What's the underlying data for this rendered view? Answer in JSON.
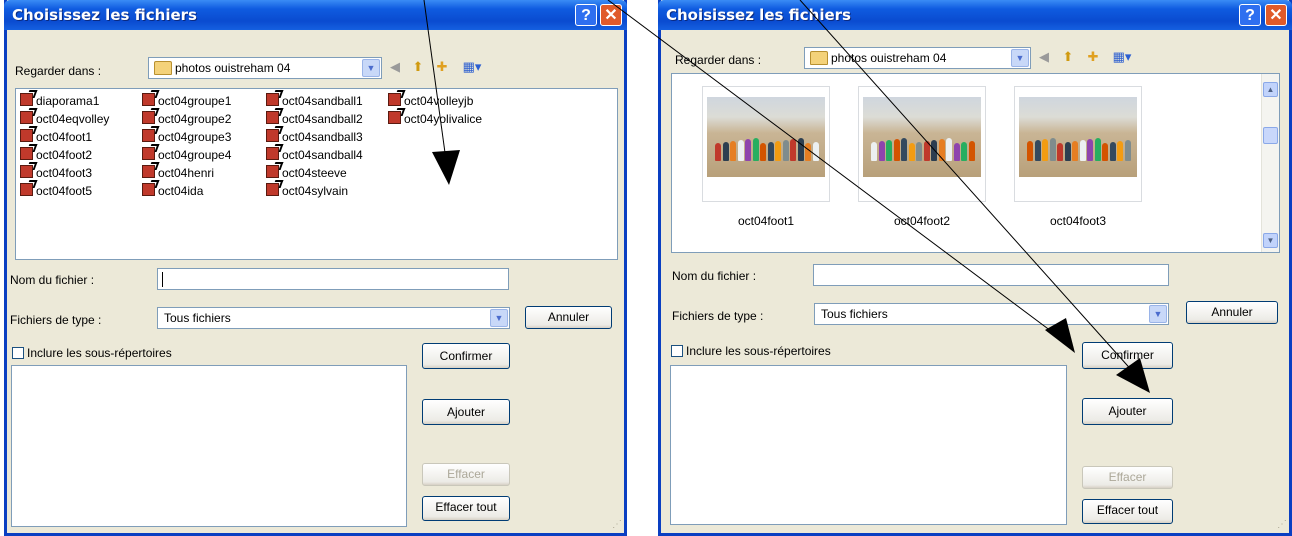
{
  "colors": {
    "titlebar": "#0a4bd0",
    "dialog_bg": "#ece9d8",
    "border": "#0a3fc2",
    "close": "#e05a2a"
  },
  "left_dialog": {
    "title": "Choisissez les fichiers",
    "help_label": "?",
    "close_label": "✕",
    "look_in_label": "Regarder dans :",
    "look_in_value": "photos ouistreham 04",
    "toolbar_icons": [
      "back-icon",
      "up-folder-icon",
      "new-folder-icon",
      "view-menu-icon"
    ],
    "files": [
      "diaporama1",
      "oct04eqvolley",
      "oct04foot1",
      "oct04foot2",
      "oct04foot3",
      "oct04foot5",
      "oct04groupe1",
      "oct04groupe2",
      "oct04groupe3",
      "oct04groupe4",
      "oct04henri",
      "oct04ida",
      "oct04sandball1",
      "oct04sandball2",
      "oct04sandball3",
      "oct04sandball4",
      "oct04steeve",
      "oct04sylvain",
      "oct04volleyjb",
      "oct04yolivalice"
    ],
    "filename_label": "Nom du fichier :",
    "filename_value": "",
    "filetype_label": "Fichiers de type :",
    "filetype_value": "Tous fichiers",
    "cancel_label": "Annuler",
    "include_sub_label": "Inclure les sous-répertoires",
    "include_sub_checked": false,
    "confirm_label": "Confirmer",
    "add_label": "Ajouter",
    "clear_label": "Effacer",
    "clear_all_label": "Effacer tout"
  },
  "right_dialog": {
    "title": "Choisissez les fichiers",
    "help_label": "?",
    "close_label": "✕",
    "look_in_label": "Regarder dans :",
    "look_in_value": "photos ouistreham 04",
    "thumbnails": [
      "oct04foot1",
      "oct04foot2",
      "oct04foot3"
    ],
    "filename_label": "Nom du fichier :",
    "filename_value": "",
    "filetype_label": "Fichiers de type :",
    "filetype_value": "Tous fichiers",
    "cancel_label": "Annuler",
    "include_sub_label": "Inclure les sous-répertoires",
    "include_sub_checked": false,
    "confirm_label": "Confirmer",
    "add_label": "Ajouter",
    "clear_label": "Effacer",
    "clear_all_label": "Effacer tout"
  }
}
